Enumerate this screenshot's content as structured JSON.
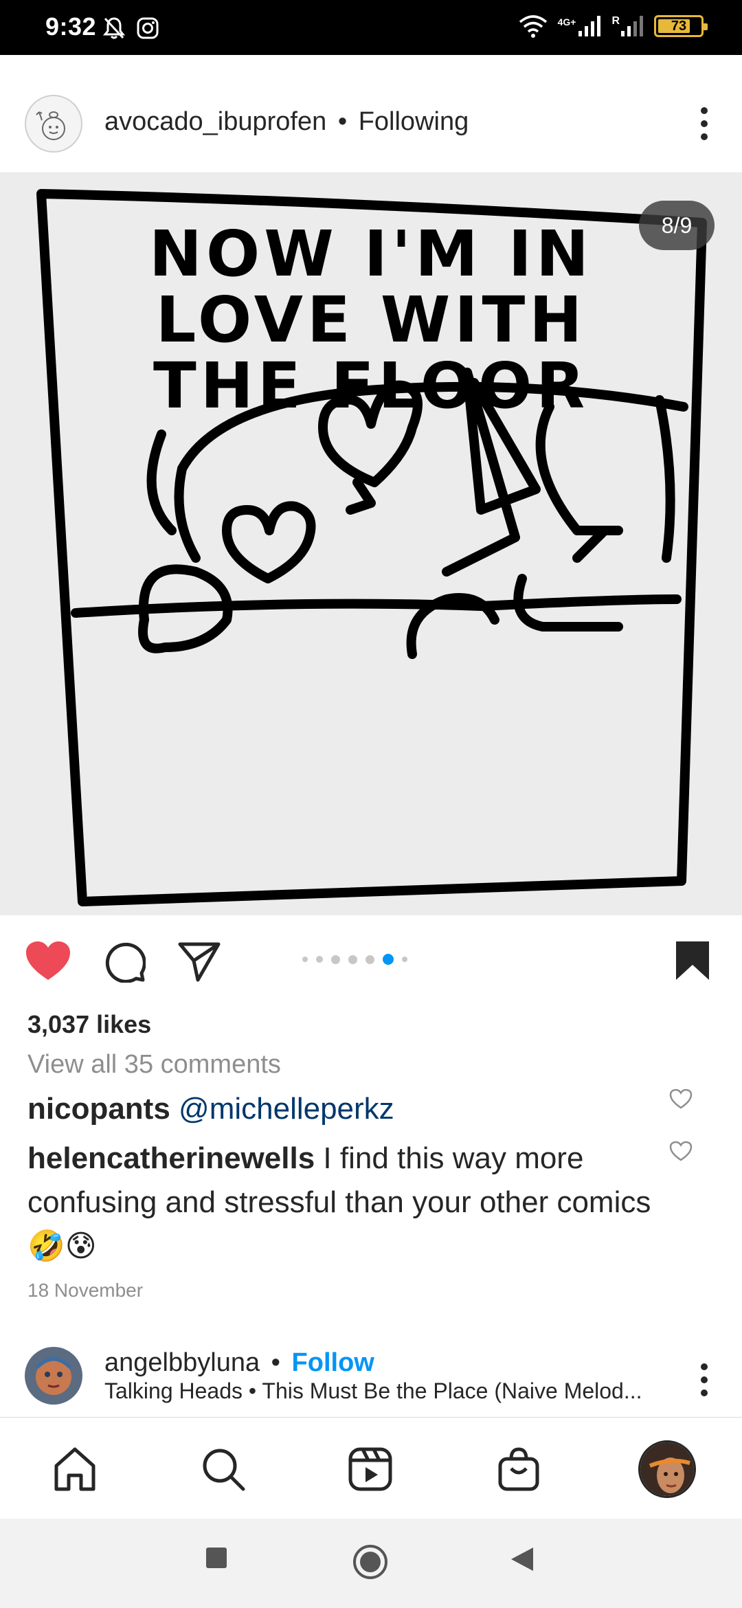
{
  "status_bar": {
    "time": "9:32",
    "network": "4G+",
    "roaming": "R",
    "battery": "73"
  },
  "post": {
    "username": "avocado_ibuprofen",
    "separator": "•",
    "follow_state": "Following",
    "counter": "8/9",
    "comic_text": [
      "NOW I'M IN",
      "LOVE WITH",
      "THE FLOOR"
    ],
    "carousel": {
      "count": 7,
      "active_index": 5
    },
    "likes": "3,037 likes",
    "view_all": "View all 35 comments",
    "comments": [
      {
        "user": "nicopants",
        "text": "@michelleperkz",
        "is_mention": true
      },
      {
        "user": "helencatherinewells",
        "text": "I find this way more confusing and stressful than your other comics",
        "emojis": "🤣😰"
      }
    ],
    "date": "18 November"
  },
  "next_post": {
    "username": "angelbbyluna",
    "separator": "•",
    "follow_label": "Follow",
    "subtitle": "Talking Heads • This Must Be the Place (Naive Melod..."
  },
  "colors": {
    "like_red": "#ed4956",
    "follow_blue": "#0095f6",
    "mention_blue": "#00376b",
    "carousel_active": "#0095f6",
    "battery": "#e7b93a"
  }
}
